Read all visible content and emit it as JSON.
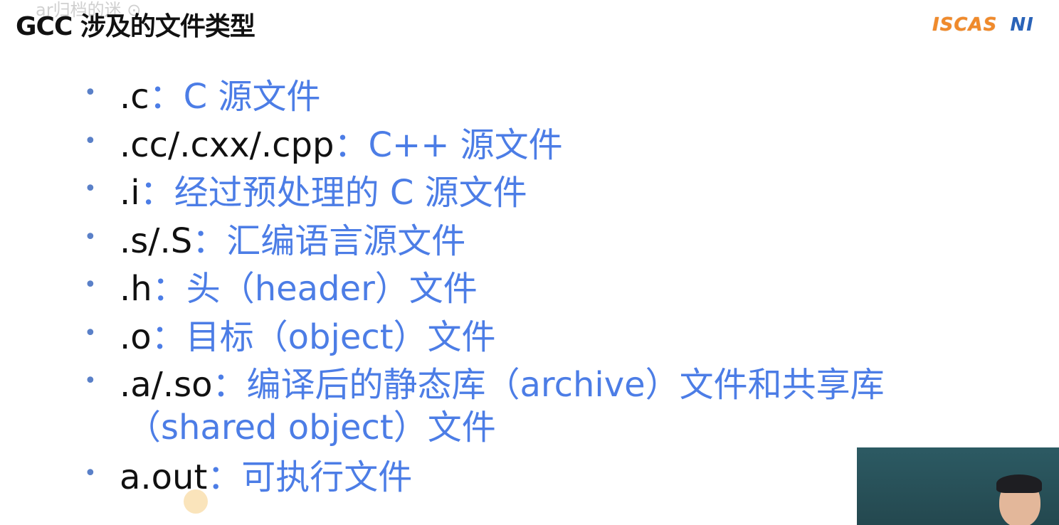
{
  "slide": {
    "watermark": "ar归档的迷 ⊙",
    "title": "GCC 涉及的文件类型",
    "logo": {
      "primary": "ISCAS",
      "secondary": "NI",
      "colors": {
        "primary": "#f08a2b",
        "secondary": "#2a63b8"
      }
    }
  },
  "bullets": [
    {
      "ext": ".c",
      "sep": "：",
      "desc": "C 源文件"
    },
    {
      "ext": ".cc/.cxx/.cpp",
      "sep": "：",
      "desc": "C++ 源文件"
    },
    {
      "ext": ".i",
      "sep": "：",
      "desc": "经过预处理的 C 源文件"
    },
    {
      "ext": ".s/.S",
      "sep": "：",
      "desc": "汇编语言源文件"
    },
    {
      "ext": ".h",
      "sep": "：",
      "desc": "头（header）文件"
    },
    {
      "ext": ".o",
      "sep": "：",
      "desc": "目标（object）文件"
    },
    {
      "ext": ".a/.so",
      "sep": "：",
      "desc": "编译后的静态库（archive）文件和共享库",
      "desc_line2": "（shared object）文件"
    },
    {
      "ext": "a.out",
      "sep": "：",
      "desc": "可执行文件"
    }
  ],
  "colors": {
    "ext_text": "#111111",
    "desc_text": "#4c7de6",
    "bullet": "#5a80c8",
    "webcam_bg": "#2d5860",
    "cursor": "#f7d696"
  }
}
